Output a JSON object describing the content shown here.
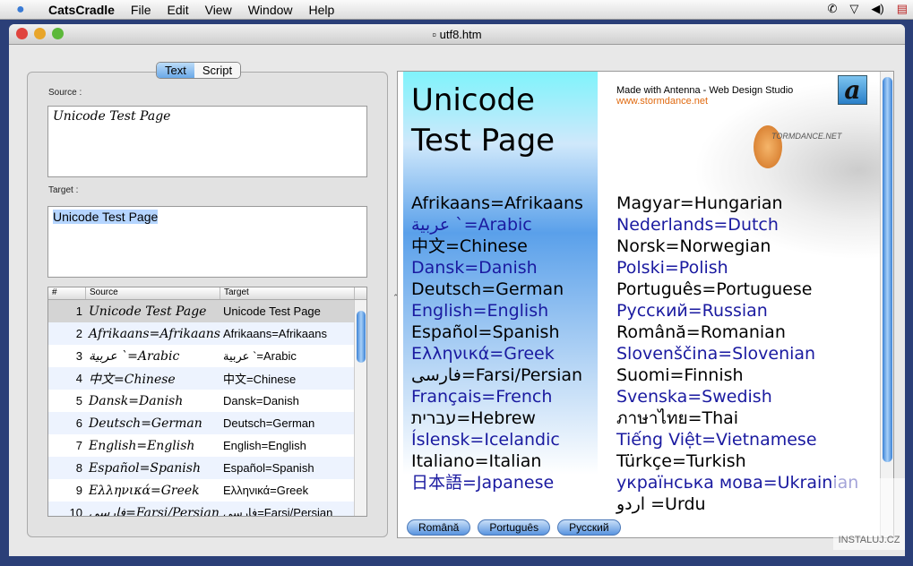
{
  "menubar": {
    "app": "CatsCradle",
    "items": [
      "File",
      "Edit",
      "View",
      "Window",
      "Help"
    ]
  },
  "window": {
    "title": "utf8.htm"
  },
  "left": {
    "segments": [
      "Text",
      "Script"
    ],
    "source_label": "Source :",
    "source_value": "Unicode Test Page",
    "target_label": "Target :",
    "target_value": "Unicode Test Page",
    "columns": [
      "#",
      "Source",
      "Target"
    ],
    "rows": [
      {
        "n": "1",
        "s": "Unicode Test Page",
        "t": "Unicode Test Page"
      },
      {
        "n": "2",
        "s": "Afrikaans=Afrikaans",
        "t": "Afrikaans=Afrikaans"
      },
      {
        "n": "3",
        "s": "عربية `=Arabic",
        "t": "عربية `=Arabic"
      },
      {
        "n": "4",
        "s": "中文=Chinese",
        "t": "中文=Chinese"
      },
      {
        "n": "5",
        "s": "Dansk=Danish",
        "t": "Dansk=Danish"
      },
      {
        "n": "6",
        "s": "Deutsch=German",
        "t": "Deutsch=German"
      },
      {
        "n": "7",
        "s": "English=English",
        "t": "English=English"
      },
      {
        "n": "8",
        "s": "Español=Spanish",
        "t": "Español=Spanish"
      },
      {
        "n": "9",
        "s": "Ελληνικά=Greek",
        "t": "Ελληνικά=Greek"
      },
      {
        "n": "10",
        "s": "فارسی=Farsi/Persian",
        "t": "فارسی=Farsi/Persian"
      }
    ]
  },
  "web": {
    "title_line1": "Unicode",
    "title_line2": "Test Page",
    "made_with": "Made with Antenna - Web Design Studio",
    "link": "www.stormdance.net",
    "logo_letter": "a",
    "storm_logo_text": "TORMDANCE.NET",
    "col1": [
      "Afrikaans=Afrikaans",
      "عربية `=Arabic",
      "中文=Chinese",
      "Dansk=Danish",
      "Deutsch=German",
      "English=English",
      "Español=Spanish",
      "Ελληνικά=Greek",
      "فارسی=Farsi/Persian",
      "Français=French",
      "עברית=Hebrew",
      "Íslensk=Icelandic",
      "Italiano=Italian",
      "日本語=Japanese"
    ],
    "col2": [
      "Magyar=Hungarian",
      "Nederlands=Dutch",
      "Norsk=Norwegian",
      "Polski=Polish",
      "Português=Portuguese",
      "Русский=Russian",
      "Română=Romanian",
      "Slovenščina=Slovenian",
      "Suomi=Finnish",
      "Svenska=Swedish",
      "ภาษาไทย=Thai",
      "Tiếng Việt=Vietnamese",
      "Türkçe=Turkish",
      "українська мова=Ukrainian",
      "اردو =Urdu"
    ],
    "buttons": [
      "Română",
      "Português",
      "Русский"
    ]
  },
  "watermark": "INSTALUJ.CZ"
}
